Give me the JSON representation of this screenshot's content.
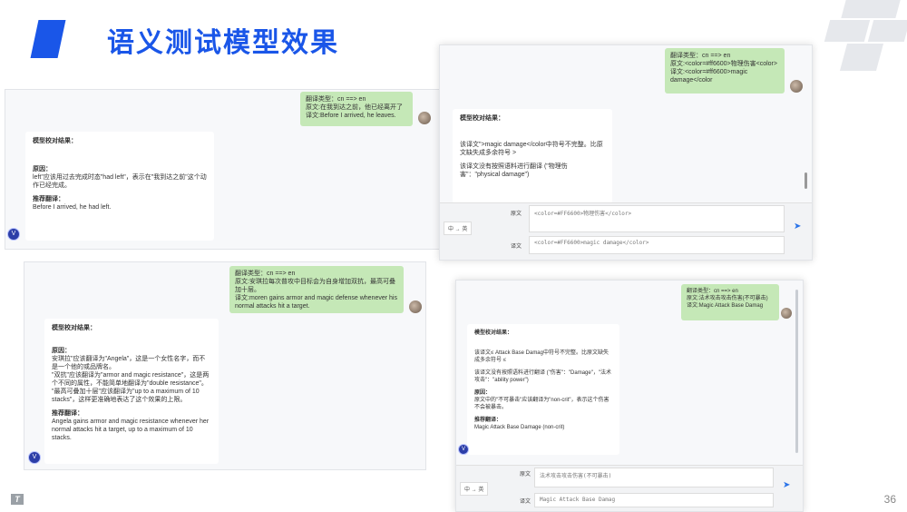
{
  "slide": {
    "title": "语义测试模型效果",
    "page_number": "36"
  },
  "panel1": {
    "bubble": [
      "翻译类型：cn ==> en",
      "原文:在我到达之前，他已经离开了",
      "译文:Before I arrived, he leaves."
    ],
    "card_heading": "模型校对结果：",
    "reason_label": "原因：",
    "reason_text": "left\"应该用过去完成时态\"had left\"，表示在\"我到达之前\"这个动作已经完成。",
    "rec_label": "推荐翻译：",
    "rec_text": "Before I arrived, he had left."
  },
  "panel2": {
    "bubble": [
      "翻译类型：cn ==> en",
      "原文:<color=#ff6600>物理伤害<color>",
      "",
      "译文:<color=#ff6600>magic damage</color"
    ],
    "card_heading": "模型校对结果：",
    "line1": "该译文\">magic damage</color中符号不完整。比原文缺失成多余符号 >",
    "line2": "该译文没有按照语料进行翻译 (\"物理伤害\"：\"physical damage\")",
    "lang_select": "中 → 英",
    "source_label": "原文",
    "source_value": "<color=#FF6600>物理伤害</color>",
    "target_label": "译文",
    "target_value": "<color=#FF6600>magic damage</color>"
  },
  "panel3": {
    "bubble": [
      "翻译类型：cn ==> en",
      "原文:安琪拉每次普攻中目标会为自身增加双抗，最高可叠加十层。",
      "译文:moren gains armor and magic defense whenever his normal attacks hit a target."
    ],
    "card_heading": "模型校对结果：",
    "reason_label": "原因：",
    "reason_lines": [
      "安琪拉\"应该翻译为\"Angela\"，这是一个女性名字，而不是一个他的或品牌名。",
      "\"双抗\"应该翻译为\"armor and magic resistance\"，这是两个不同的属性，不能简单地翻译为\"double resistance\"。",
      "\"最高可叠加十层\"应该翻译为\"up to a maximum of 10 stacks\"，这样更准确地表达了这个效果的上限。"
    ],
    "rec_label": "推荐翻译：",
    "rec_text": "Angela gains armor and magic resistance whenever her normal attacks hit a target, up to a maximum of 10 stacks."
  },
  "panel4": {
    "bubble": [
      "翻译类型：cn ==> en",
      "原文:法术攻击攻击伤害(不可暴击)",
      "",
      "译文:Magic Attack Base Damag"
    ],
    "card_heading": "模型校对结果：",
    "line1": "该译文≤ Attack Base Damag中符号不完整。比原文缺失成多余符号 ≤",
    "line2": "该译文没有按照语料进行翻译 (\"伤害\"：\"Damage\"，\"法术攻击\"：\"ability power\")",
    "reason_label": "原因：",
    "reason_text": "原文中的\"不可暴击\"应该翻译为\"non-crit\"，表示这个伤害不会被暴击。",
    "rec_label": "推荐翻译：",
    "rec_text": "Magic Attack Base Damage (non-crit)",
    "lang_select": "中 → 英",
    "source_label": "原文",
    "source_value": "法术攻击攻击伤害(不可暴击)",
    "target_label": "译文",
    "target_value": "Magic Attack Base Damag"
  },
  "colors": {
    "accent": "#1a56e8",
    "bubble": "#c5e8b7"
  }
}
